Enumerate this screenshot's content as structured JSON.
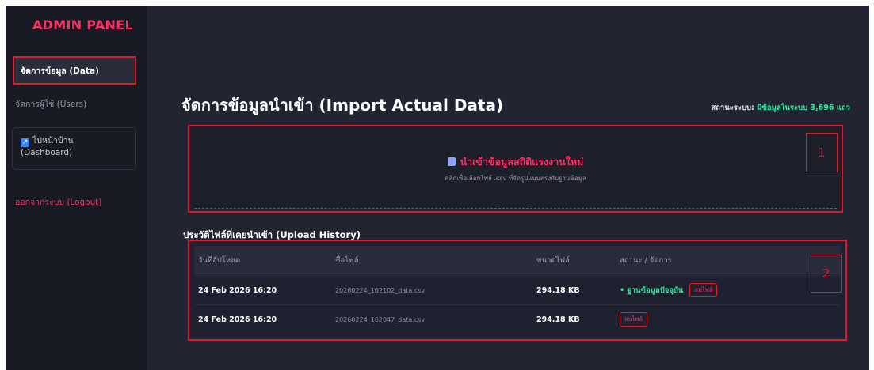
{
  "sidebar": {
    "brand": "ADMIN PANEL",
    "items": [
      {
        "label": "จัดการข้อมูล (Data)"
      },
      {
        "label": "จัดการผู้ใช้ (Users)"
      },
      {
        "label": "ไปหน้าบ้าน",
        "label2": "(Dashboard)"
      },
      {
        "label": "ออกจากระบบ (Logout)"
      }
    ]
  },
  "main": {
    "title": "จัดการข้อมูลนำเข้า (Import Actual Data)",
    "status_label": "สถานะระบบ:",
    "status_value": "มีข้อมูลในระบบ 3,696 แถว",
    "upload": {
      "title": "นำเข้าข้อมูลสถิติแรงงานใหม่",
      "subtitle": "คลิกเพื่อเลือกไฟล์ .csv ที่จัดรูปแบบตรงกับฐานข้อมูล"
    },
    "markers": [
      "1",
      "2"
    ],
    "history": {
      "title": "ประวัติไฟล์ที่เคยนำเข้า (Upload History)",
      "columns": [
        "วันที่อัปโหลด",
        "ชื่อไฟล์",
        "ขนาดไฟล์",
        "สถานะ / จัดการ"
      ],
      "rows": [
        {
          "date": "24 Feb 2026 16:20",
          "filename": "20260224_162102_data.csv",
          "size": "294.18 KB",
          "status": "• ฐานข้อมูลปัจจุบัน",
          "action": "ลบไฟล์"
        },
        {
          "date": "24 Feb 2026 16:20",
          "filename": "20260224_162047_data.csv",
          "size": "294.18 KB",
          "status": "",
          "action": "ลบไฟล์"
        }
      ]
    }
  },
  "colors": {
    "accent": "#ff2e63",
    "highlight_border": "#e0192e",
    "success": "#2ee6a0",
    "sidebar_bg": "#181a24",
    "main_bg": "#222431"
  }
}
